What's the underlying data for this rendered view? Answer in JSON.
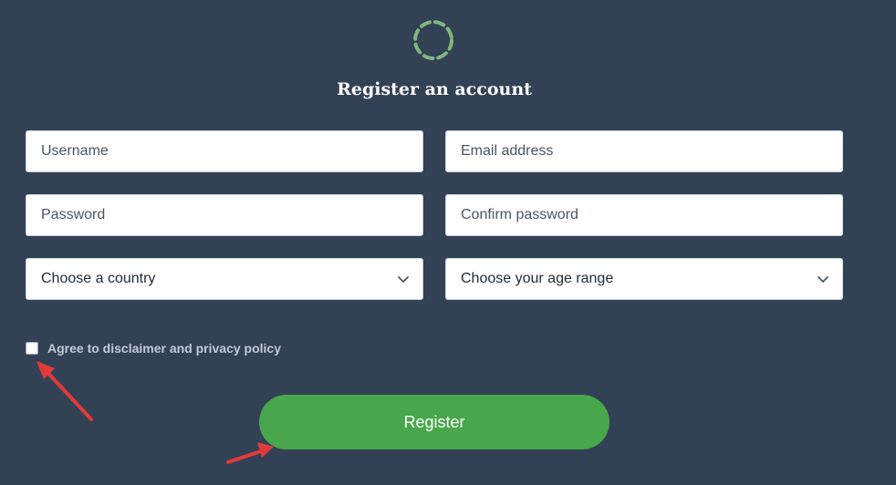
{
  "form": {
    "title": "Register an account",
    "username_placeholder": "Username",
    "email_placeholder": "Email address",
    "password_placeholder": "Password",
    "confirm_password_placeholder": "Confirm password",
    "country_select_value": "Choose a country",
    "age_select_value": "Choose your age range",
    "agree_label": "Agree to disclaimer and privacy policy",
    "agree_checked": false,
    "register_button_label": "Register"
  },
  "icons": {
    "logo": "dashed-circle-icon",
    "select_chevron": "chevron-down-icon",
    "annotation_arrow": "red-arrow-icon"
  },
  "colors": {
    "background": "#334155",
    "accent_green": "#48a64c",
    "logo_green": "#7fb77e",
    "annotation_red": "#e23a3a"
  }
}
